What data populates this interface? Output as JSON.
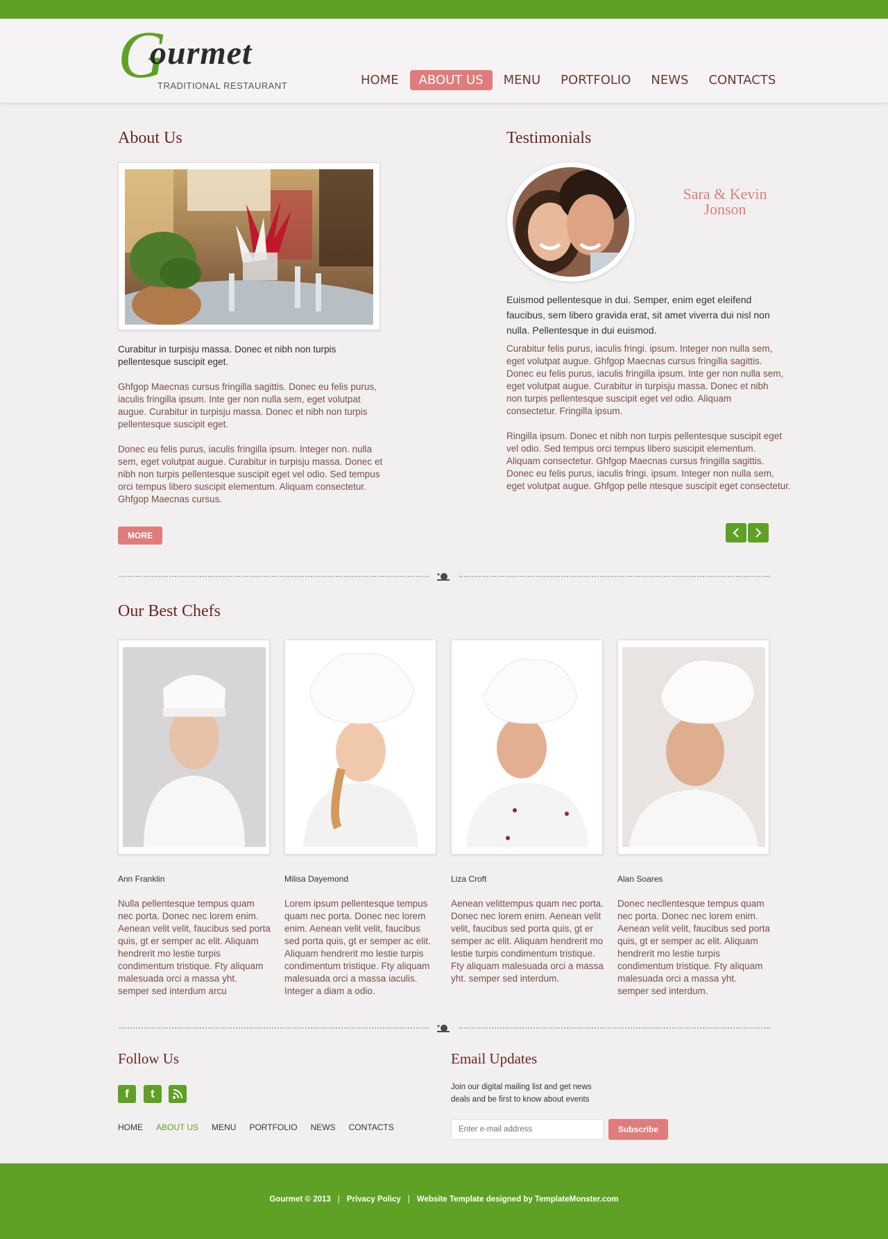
{
  "brand": {
    "logo_initial": "G",
    "logo_rest": "ourmet",
    "tagline": "TRADITIONAL RESTAURANT",
    "accent_green": "#5ea124",
    "accent_pink": "#e07c7c",
    "heading_color": "#6b2424"
  },
  "nav": {
    "items": [
      {
        "label": "HOME",
        "active": false
      },
      {
        "label": "ABOUT US",
        "active": true
      },
      {
        "label": "MENU",
        "active": false
      },
      {
        "label": "PORTFOLIO",
        "active": false
      },
      {
        "label": "NEWS",
        "active": false
      },
      {
        "label": "CONTACTS",
        "active": false
      }
    ]
  },
  "about": {
    "title": "About Us",
    "lead": "Curabitur in turpisju massa. Donec et nibh non turpis pellentesque suscipit eget.",
    "para1": "Ghfgop Maecnas cursus fringilla sagittis. Donec eu felis purus, iaculis fringilla ipsum. Inte ger non nulla sem, eget volutpat augue. Curabitur in turpisju massa. Donec et nibh non turpis pellentesque suscipit eget.",
    "para2": "Donec eu felis purus, iaculis fringilla ipsum. Integer non. nulla sem, eget volutpat augue. Curabitur in turpisju massa. Donec et nibh non turpis pellentesque suscipit eget vel odio. Sed tempus orci tempus libero suscipit elementum. Aliquam consectetur. Ghfgop Maecnas cursus.",
    "more_label": "MORE"
  },
  "testimonials": {
    "title": "Testimonials",
    "name_line1": "Sara & Kevin",
    "name_line2": "Jonson",
    "lead": "Euismod pellentesque in dui. Semper, enim eget eleifend faucibus, sem libero gravida erat, sit amet viverra dui nisl non nulla. Pellentesque in dui euismod.",
    "para1": "Curabitur felis purus, iaculis fringi. ipsum. Integer non nulla sem, eget volutpat augue. Ghfgop Maecnas cursus fringilla sagittis. Donec eu felis purus, iaculis fringilla ipsum. Inte ger non nulla sem, eget volutpat augue. Curabitur in turpisju massa. Donec et nibh non turpis pellentesque suscipit eget vel odio. Aliquam consectetur. Fringilla ipsum.",
    "para2": "Ringilla ipsum. Donec et nibh non turpis pellentesque suscipit eget vel odio. Sed tempus orci tempus libero suscipit elementum. Aliquam consectetur. Ghfgop Maecnas cursus fringilla sagittis. Donec eu felis purus, iaculis fringi. ipsum. Integer non nulla sem, eget volutpat augue. Ghfgop pelle ntesque suscipit eget consectetur."
  },
  "chefs": {
    "title": "Our Best Chefs",
    "items": [
      {
        "name": "Ann Franklin",
        "bio": "Nulla pellentesque tempus quam nec porta. Donec nec lorem enim. Aenean velit velit, faucibus sed porta quis, gt er semper ac elit. Aliquam hendrerit mo lestie turpis condimentum tristique. Fty aliquam malesuada orci a massa yht. semper sed interdum arcu"
      },
      {
        "name": "Milisa Dayemond",
        "bio": "Lorem ipsum pellentesque tempus quam nec porta. Donec nec lorem enim. Aenean velit velit, faucibus sed porta quis, gt er semper ac elit. Aliquam hendrerit mo lestie turpis condimentum tristique. Fty aliquam malesuada orci a massa iaculis. Integer a diam a odio."
      },
      {
        "name": "Liza Croft",
        "bio": "Aenean velittempus quam nec porta. Donec nec lorem enim. Aenean velit velit, faucibus sed porta quis, gt er semper ac elit. Aliquam hendrerit mo lestie turpis condimentum tristique. Fty aliquam malesuada orci a massa yht. semper sed interdum."
      },
      {
        "name": "Alan Soares",
        "bio": "Donec necllentesque tempus quam nec porta. Donec nec lorem enim. Aenean velit velit, faucibus sed porta quis, gt er semper ac elit. Aliquam hendrerit mo lestie turpis condimentum tristique. Fty aliquam malesuada orci a massa yht. semper sed interdum."
      }
    ]
  },
  "follow": {
    "title": "Follow Us",
    "icons": [
      "facebook-icon",
      "twitter-icon",
      "rss-icon"
    ]
  },
  "footer_nav": {
    "items": [
      {
        "label": "HOME",
        "active": false
      },
      {
        "label": "ABOUT US",
        "active": true
      },
      {
        "label": "MENU",
        "active": false
      },
      {
        "label": "PORTFOLIO",
        "active": false
      },
      {
        "label": "NEWS",
        "active": false
      },
      {
        "label": "CONTACTS",
        "active": false
      }
    ]
  },
  "email": {
    "title": "Email Updates",
    "text": "Join our digital mailing list and get news deals and be first to know about events",
    "placeholder": "Enter e-mail address",
    "button": "Subscribe"
  },
  "footer": {
    "copyright": "Gourmet © 2013",
    "privacy": "Privacy Policy",
    "credit": "Website Template designed by TemplateMonster.com",
    "separator": "|"
  }
}
